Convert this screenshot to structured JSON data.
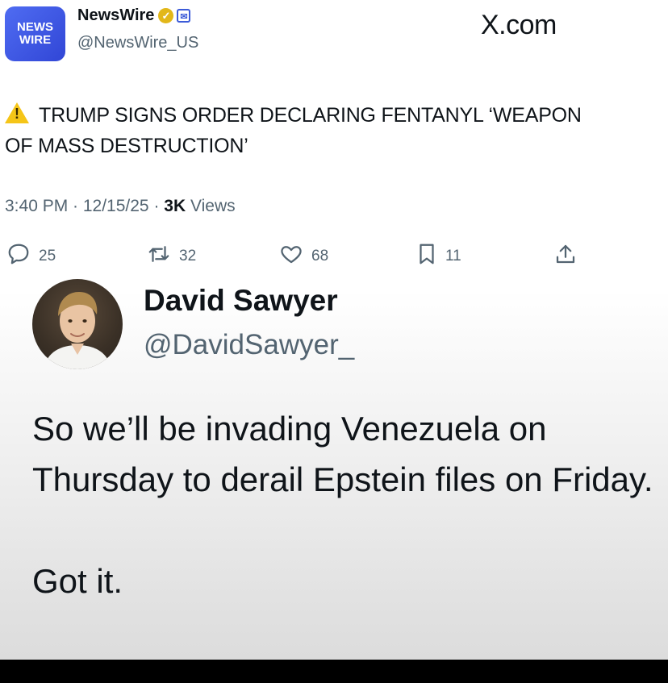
{
  "source_post": {
    "logo_text_line1": "NEWS",
    "logo_text_line2": "WIRE",
    "name": "NewsWire",
    "handle": "@NewsWire_US",
    "site": "X.com",
    "headline": "TRUMP SIGNS ORDER DECLARING FENTANYL ‘WEAPON OF MASS DESTRUCTION’",
    "time": "3:40 PM · 12/15/25 · ",
    "views_count": "3K",
    "views_label": " Views",
    "actions": {
      "replies": "25",
      "reposts": "32",
      "likes": "68",
      "bookmarks": "11"
    }
  },
  "reply_post": {
    "name": "David Sawyer",
    "handle": "@DavidSawyer_",
    "body": "So we’ll be invading Venezuela on Thursday to derail Epstein files on Friday.\n\nGot it."
  },
  "colors": {
    "text": "#0f1419",
    "secondary": "#536471",
    "logo": "#3c5bd8",
    "verified": "#e2b719"
  }
}
